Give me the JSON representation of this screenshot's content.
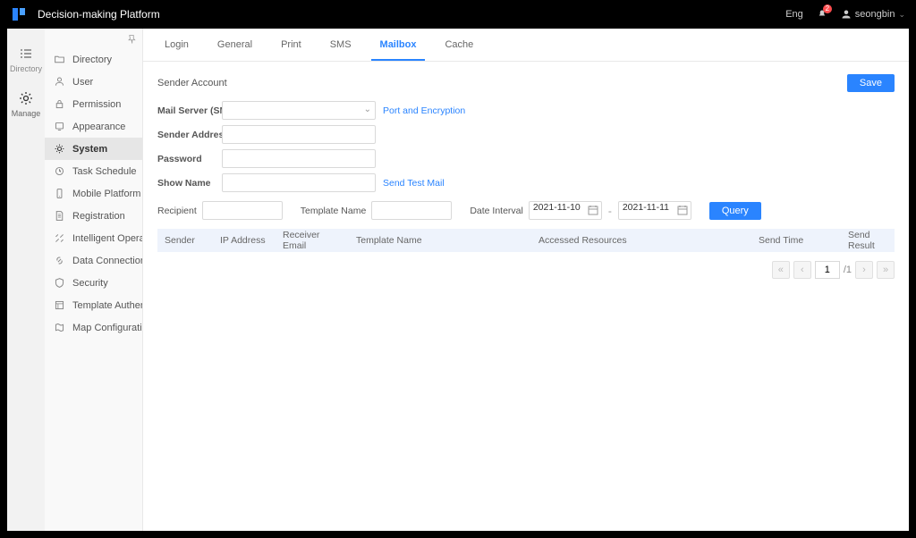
{
  "app": {
    "title": "Decision-making Platform"
  },
  "header": {
    "lang": "Eng",
    "notif_count": "2",
    "user": "seongbin"
  },
  "rail": {
    "directory": "Directory",
    "manage": "Manage"
  },
  "sidebar": {
    "items": [
      "Directory",
      "User",
      "Permission",
      "Appearance",
      "System",
      "Task Schedule",
      "Mobile Platform",
      "Registration",
      "Intelligent Operatio...",
      "Data Connection",
      "Security",
      "Template Authenti...",
      "Map Configuration"
    ]
  },
  "tabs": [
    "Login",
    "General",
    "Print",
    "SMS",
    "Mailbox",
    "Cache"
  ],
  "section": {
    "title": "Sender Account",
    "save": "Save"
  },
  "form": {
    "mail_server_label": "Mail Server (SMTP)",
    "port_link": "Port and Encryption",
    "sender_address_label": "Sender Address",
    "password_label": "Password",
    "show_name_label": "Show Name",
    "send_test_link": "Send Test Mail"
  },
  "query": {
    "recipient_label": "Recipient",
    "template_label": "Template Name",
    "date_interval_label": "Date Interval",
    "date_from": "2021-11-10",
    "date_to": "2021-11-11",
    "query_btn": "Query"
  },
  "table": {
    "headers": {
      "sender": "Sender",
      "ip": "IP Address",
      "rcv": "Receiver Email",
      "tpl": "Template Name",
      "acc": "Accessed Resources",
      "sent": "Send Time",
      "res": "Send Result"
    }
  },
  "pagination": {
    "page": "1",
    "total": "/1"
  }
}
